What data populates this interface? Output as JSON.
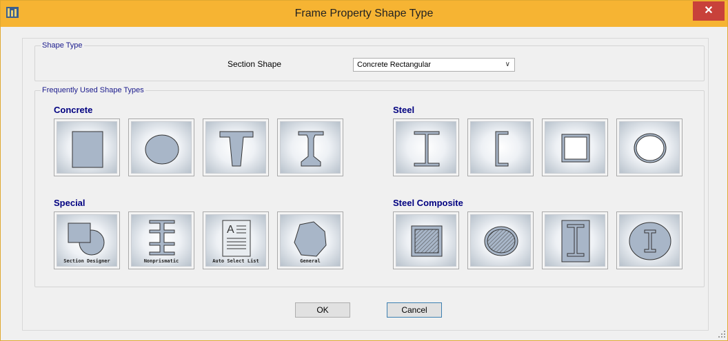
{
  "window": {
    "title": "Frame Property Shape Type",
    "close_label": "✕"
  },
  "shape_type": {
    "group_label": "Shape Type",
    "section_shape_label": "Section Shape",
    "section_shape_value": "Concrete Rectangular"
  },
  "frequent": {
    "group_label": "Frequently Used Shape Types",
    "concrete_label": "Concrete",
    "steel_label": "Steel",
    "special_label": "Special",
    "steel_composite_label": "Steel Composite",
    "special_captions": {
      "section_designer": "Section Designer",
      "nonprismatic": "Nonprismatic",
      "auto_select_list": "Auto Select List",
      "general": "General"
    }
  },
  "buttons": {
    "ok": "OK",
    "cancel": "Cancel"
  },
  "colors": {
    "titlebar": "#f6b433",
    "close": "#c8413a",
    "shape_fill": "#a8b6c8",
    "category_text": "#000080"
  }
}
